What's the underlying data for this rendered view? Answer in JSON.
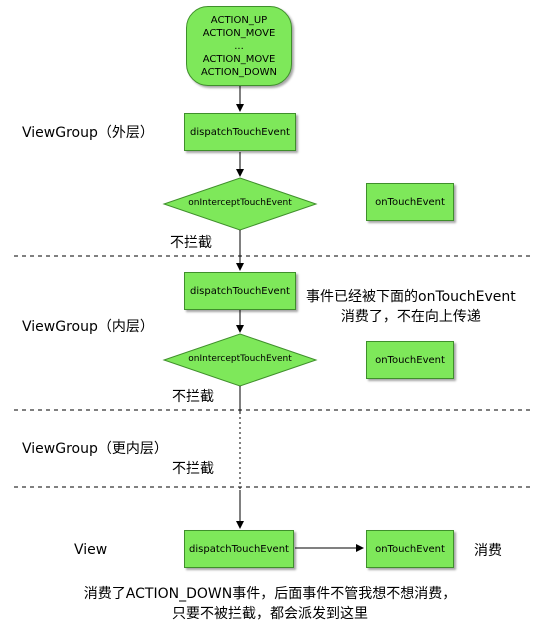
{
  "start_node": {
    "lines": [
      "ACTION_UP",
      "ACTION_MOVE",
      "...",
      "ACTION_MOVE",
      "ACTION_DOWN"
    ]
  },
  "outer": {
    "label": "ViewGroup（外层）",
    "dispatch": "dispatchTouchEvent",
    "intercept": "onInterceptTouchEvent",
    "touch": "onTouchEvent",
    "no_intercept": "不拦截"
  },
  "inner": {
    "label": "ViewGroup（内层）",
    "dispatch": "dispatchTouchEvent",
    "intercept": "onInterceptTouchEvent",
    "touch": "onTouchEvent",
    "no_intercept": "不拦截",
    "note_line1": "事件已经被下面的onTouchEvent",
    "note_line2": "消费了，不在向上传递"
  },
  "innermost": {
    "label": "ViewGroup（更内层）",
    "no_intercept": "不拦截"
  },
  "view": {
    "label": "View",
    "dispatch": "dispatchTouchEvent",
    "touch": "onTouchEvent",
    "consume": "消费"
  },
  "footer": {
    "line1": "消费了ACTION_DOWN事件，后面事件不管我想不想消费，",
    "line2": "只要不被拦截，都会派发到这里"
  }
}
